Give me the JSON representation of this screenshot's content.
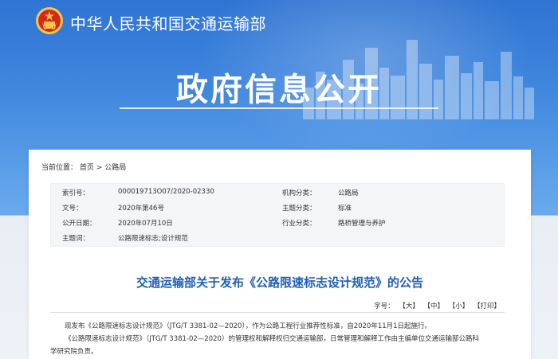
{
  "header": {
    "ministry_name": "中华人民共和国交通运输部",
    "hero_title": "政府信息公开"
  },
  "breadcrumb": {
    "prefix": "当前位置：",
    "home": "首页",
    "separator": " > ",
    "current": "公路局"
  },
  "metadata": {
    "index_label": "索引号：",
    "index_value": "000019713O07/2020-02330",
    "org_label": "机构分类：",
    "org_value": "公路局",
    "doc_no_label": "文号：",
    "doc_no_value": "2020年第46号",
    "topic_label": "主题分类：",
    "topic_value": "标准",
    "date_label": "公开日期：",
    "date_value": "2020年07月10日",
    "industry_label": "行业分类：",
    "industry_value": "路桥管理与养护",
    "keywords_label": "主题词：",
    "keywords_value": "公路限速标志;设计规范"
  },
  "article": {
    "title": "交通运输部关于发布《公路限速标志设计规范》的公告",
    "font_size_label": "字号：",
    "font_large": "【大】",
    "font_medium": "【中】",
    "font_small": "【小】",
    "print": "【打印】",
    "para1": "现发布《公路限速标志设计规范》（JTG/T 3381-02—2020），作为公路工程行业推荐性标准，自2020年11月1日起施行。",
    "para2": "《公路限速标志设计规范》（JTG/T 3381-02—2020）的管理权和解释权归交通运输部，日常管理和解释工作由主编单位交通运输部公路科",
    "para3": "学研究院负责。"
  },
  "colors": {
    "banner": "#3f86de",
    "title_blue": "#1f5fb3",
    "emblem_red": "#d7261e",
    "emblem_gold": "#f5c84c"
  }
}
